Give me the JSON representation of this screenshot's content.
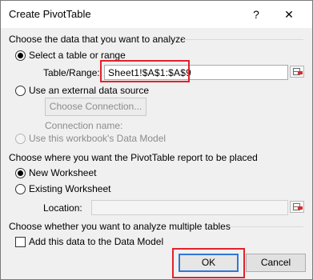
{
  "dialog": {
    "title": "Create PivotTable",
    "help_glyph": "?",
    "close_glyph": "✕"
  },
  "section_data": {
    "label": "Choose the data that you want to analyze",
    "option_table": "Select a table or range",
    "table_range_label": "Table/Range:",
    "table_range_value": "Sheet1!$A$1:$A$9",
    "option_external": "Use an external data source",
    "choose_connection_button": "Choose Connection...",
    "connection_name_label": "Connection name:",
    "option_data_model": "Use this workbook's Data Model"
  },
  "section_placement": {
    "label": "Choose where you want the PivotTable report to be placed",
    "option_new": "New Worksheet",
    "option_existing": "Existing Worksheet",
    "location_label": "Location:",
    "location_value": ""
  },
  "section_multiple": {
    "label": "Choose whether you want to analyze multiple tables",
    "add_to_model": "Add this data to the Data Model",
    "add_to_model_checked": false
  },
  "buttons": {
    "ok": "OK",
    "cancel": "Cancel"
  },
  "icons": {
    "help": "help-icon",
    "close": "close-icon",
    "collapse": "collapse-dialog-icon"
  },
  "colors": {
    "highlight": "#e3222a",
    "default_button_border": "#2f78d6"
  }
}
